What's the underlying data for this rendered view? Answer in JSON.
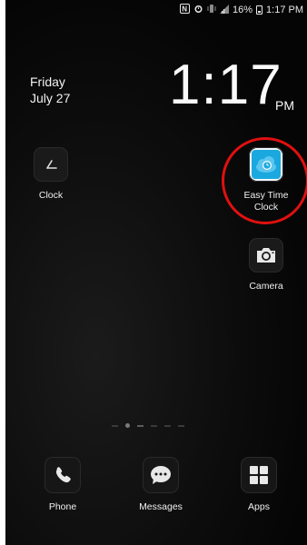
{
  "status_bar": {
    "battery": "16%",
    "time": "1:17 PM",
    "icons": [
      "nfc-icon",
      "alarm-icon",
      "vibrate-icon",
      "signal-icon",
      "battery-icon"
    ]
  },
  "clock_widget": {
    "day": "Friday",
    "date": "July 27",
    "time": "1:17",
    "ampm": "PM"
  },
  "apps": {
    "clock": {
      "label": "Clock",
      "icon": "clock-icon"
    },
    "easy_time_clock": {
      "label_line1": "Easy Time",
      "label_line2": "Clock",
      "icon": "cloud-clock-icon"
    },
    "camera": {
      "label": "Camera",
      "icon": "camera-icon"
    }
  },
  "dock": {
    "phone": {
      "label": "Phone",
      "icon": "phone-icon"
    },
    "messages": {
      "label": "Messages",
      "icon": "messages-icon"
    },
    "apps": {
      "label": "Apps",
      "icon": "apps-grid-icon"
    }
  },
  "colors": {
    "highlight": "#e01010",
    "easy_time_clock_bg": "#1aa8df"
  }
}
